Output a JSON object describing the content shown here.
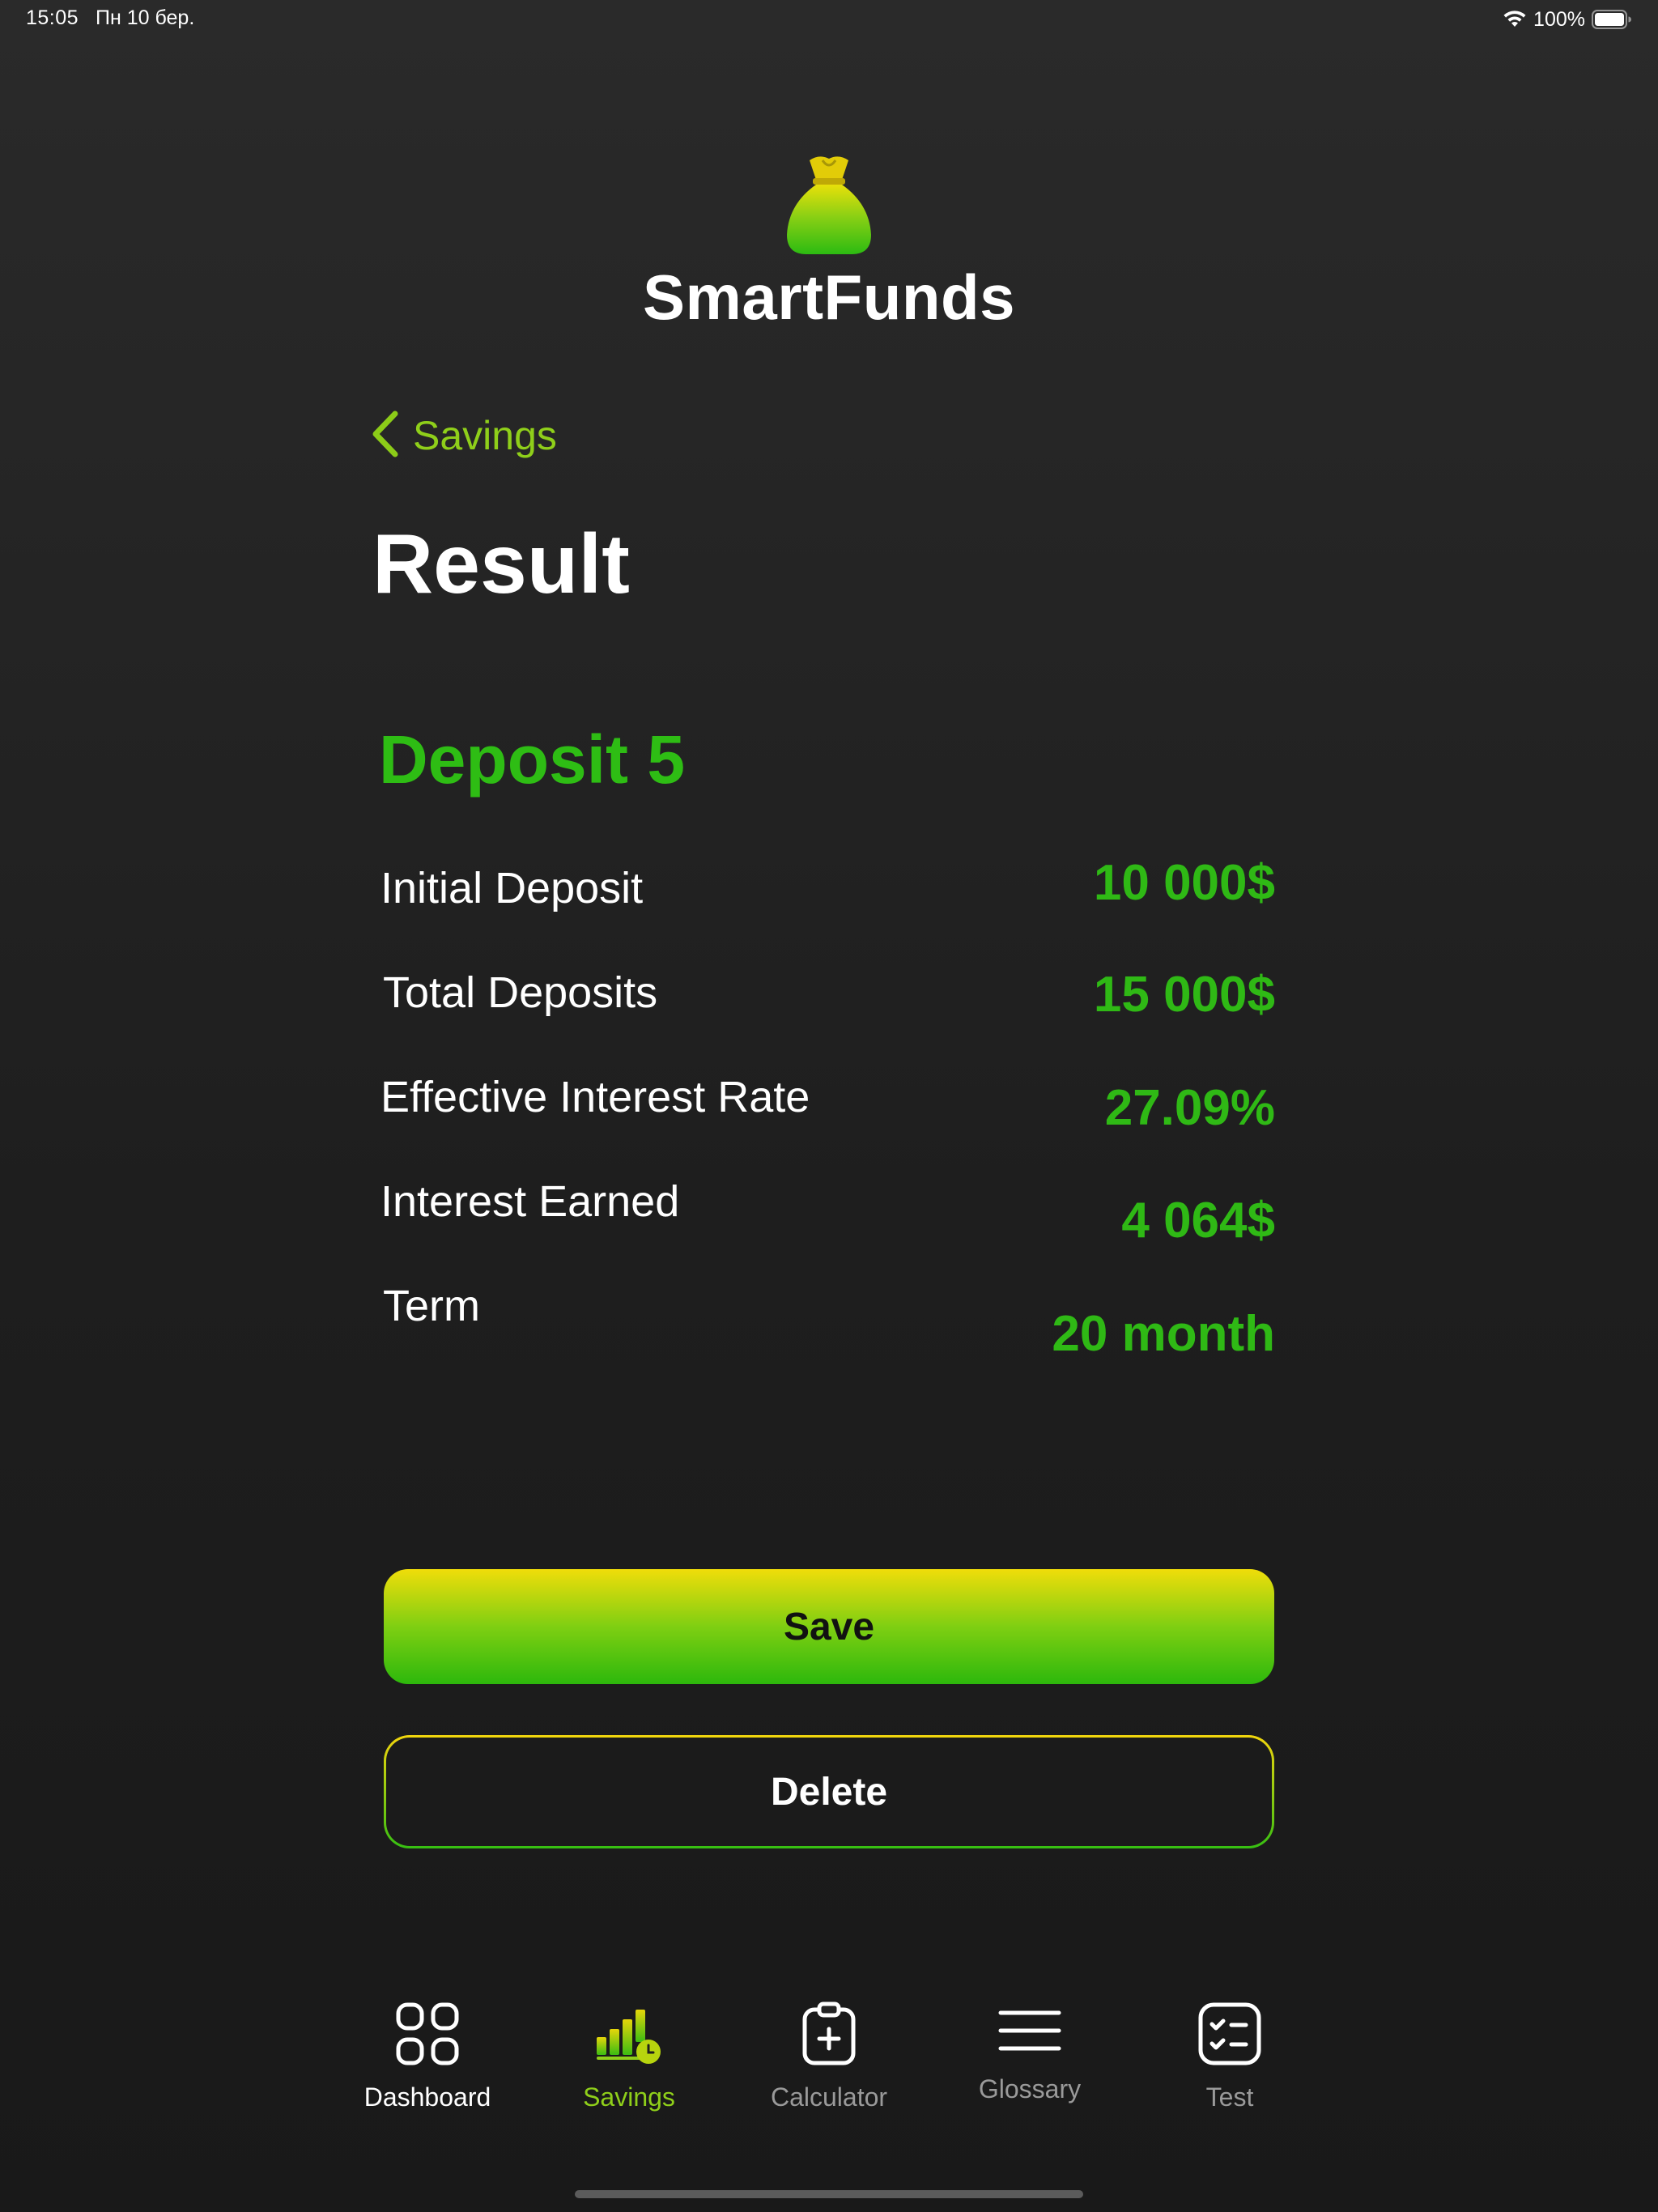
{
  "status_bar": {
    "time": "15:05",
    "date": "Пн 10 бер.",
    "battery_percent": "100%",
    "battery_level": 1.0,
    "icons": [
      "wifi-icon",
      "battery-icon"
    ]
  },
  "header": {
    "logo_icon": "money-bag-icon",
    "app_name": "SmartFunds"
  },
  "navigation": {
    "back_label": "Savings",
    "back_icon": "chevron-left-icon"
  },
  "page": {
    "title": "Result"
  },
  "result": {
    "deposit_name": "Deposit 5",
    "rows": [
      {
        "label": "Initial Deposit",
        "value": "10 000$"
      },
      {
        "label": "Total Deposits",
        "value": "15 000$"
      },
      {
        "label": "Effective Interest Rate",
        "value": "27.09%"
      },
      {
        "label": "Interest Earned",
        "value": "4 064$"
      },
      {
        "label": "Term",
        "value": "20 month"
      }
    ]
  },
  "actions": {
    "save_label": "Save",
    "delete_label": "Delete"
  },
  "tab_bar": {
    "selected": "Savings",
    "items": [
      {
        "label": "Dashboard",
        "icon": "grid-icon"
      },
      {
        "label": "Savings",
        "icon": "savings-chart-icon"
      },
      {
        "label": "Calculator",
        "icon": "clipboard-plus-icon"
      },
      {
        "label": "Glossary",
        "icon": "menu-lines-icon"
      },
      {
        "label": "Test",
        "icon": "checklist-icon"
      }
    ]
  },
  "colors": {
    "background": "#222222",
    "accent_green": "#2fb915",
    "accent_yellow": "#f0dd0a",
    "back_link": "#8fcf1a",
    "tab_inactive": "#9a9a9a"
  }
}
